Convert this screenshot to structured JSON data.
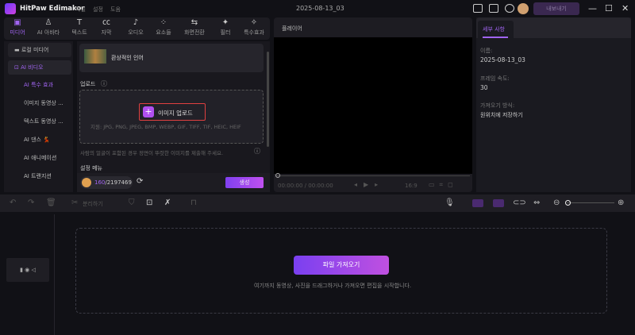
{
  "app": {
    "name": "HitPaw Edimakor",
    "menu": [
      "파일",
      "설정",
      "도움"
    ],
    "project": "2025-08-13_03",
    "export_label": "내보내기",
    "accent": "#a064f0"
  },
  "toolbar_tabs": [
    {
      "label": "미디어",
      "icon": "image"
    },
    {
      "label": "AI 아바타",
      "icon": "avatar"
    },
    {
      "label": "텍스트",
      "icon": "T"
    },
    {
      "label": "자막",
      "icon": "cc"
    },
    {
      "label": "오디오",
      "icon": "music"
    },
    {
      "label": "요소들",
      "icon": "elements"
    },
    {
      "label": "화면전환",
      "icon": "transition"
    },
    {
      "label": "필터",
      "icon": "filter"
    },
    {
      "label": "특수효과",
      "icon": "effects"
    }
  ],
  "sidebar": [
    {
      "label": "로컬 미디어"
    },
    {
      "label": "AI 비디오"
    },
    {
      "label": "AI 특수 효과"
    },
    {
      "label": "이미지 동영상 ..."
    },
    {
      "label": "텍스트 동영상 ..."
    },
    {
      "label": "AI 댄스 💃"
    },
    {
      "label": "AI 애니메이션"
    },
    {
      "label": "AI 트랜지션"
    }
  ],
  "content": {
    "effect_name": "환상적인 인어",
    "upload_label": "업로드",
    "upload_button": "이미지 업로드",
    "formats": "지원: JPG, PNG, JPEG, BMP, WEBP, GIF, TIFF, TIF, HEIC, HEIF",
    "hint": "사람의 얼굴이 포함된 경우 정면이 뚜렷한 이미지를 제출해 주세요.",
    "settings_label": "설정 메뉴",
    "credits_used": "160",
    "credits_total": "/2197469",
    "generate": "생성"
  },
  "player": {
    "title": "플레이어",
    "time": "00:00:00 / 00:00:00",
    "ratio": "16:9"
  },
  "details": {
    "tab": "세부 사항",
    "name_label": "이름:",
    "name": "2025-08-13_03",
    "fps_label": "프레임 속도:",
    "fps": "30",
    "import_label": "가져오기 방식:",
    "import_value": "원위치에 저장하기"
  },
  "timeline": {
    "split_label": "분리하기",
    "import_button": "파일 가져오기",
    "drop_hint": "여기까지 동영상, 사진을 드래그하거나 가져오면 편집을 시작합니다."
  }
}
